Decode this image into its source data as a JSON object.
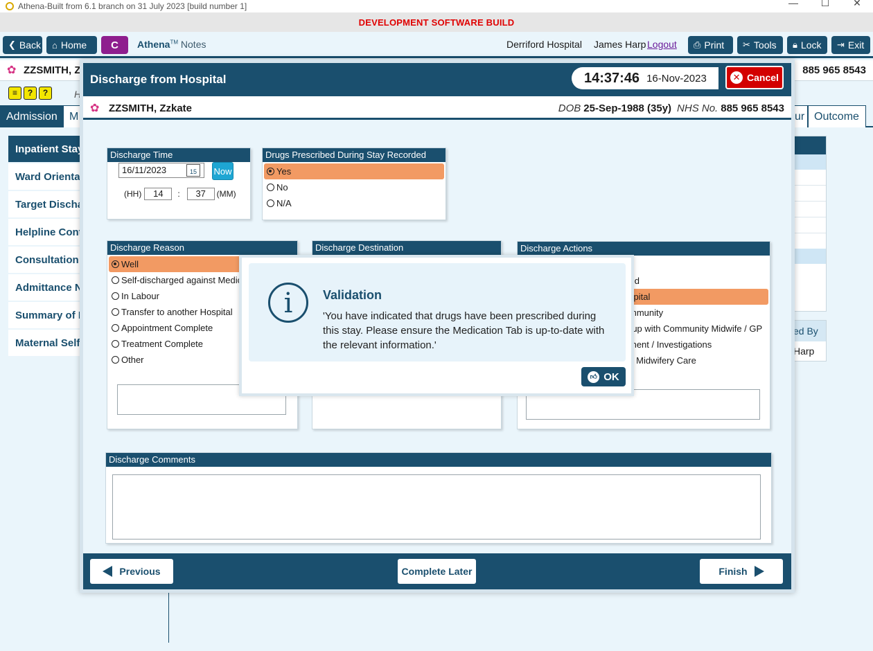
{
  "window": {
    "title": "Athena-Built from 6.1 branch on 31 July 2023 [build number 1]",
    "min_icon": "—",
    "max_icon": "☐",
    "close_icon": "✕"
  },
  "banner": "DEVELOPMENT SOFTWARE BUILD",
  "toolbar": {
    "back": "Back",
    "home": "Home",
    "c": "C",
    "app_name": "Athena",
    "tm": "TM",
    "notes": "Notes",
    "hospital": "Derriford Hospital",
    "user": "James Harp",
    "logout": "Logout",
    "print": "Print",
    "tools": "Tools",
    "lock": "Lock",
    "exit": "Exit"
  },
  "background": {
    "patient_name": "ZZSMITH, Z",
    "nhs_partial": "885 965 8543",
    "h_label": "H",
    "tabs": [
      "Admission",
      "M",
      "ur",
      "Outcome"
    ],
    "side_nav": [
      "Inpatient Stay",
      "Ward Orientat",
      "Target Discha",
      "Helpline Cont",
      "Consultation I",
      "Admittance N",
      "Summary of P",
      "Maternal Self"
    ],
    "recorded_by_label": "ed By",
    "recorded_by_value": "Harp"
  },
  "dialog": {
    "title": "Discharge from Hospital",
    "time": "14:37:46",
    "date": "16-Nov-2023",
    "cancel": "Cancel",
    "patient": {
      "name": "ZZSMITH, Zzkate",
      "dob_label": "DOB",
      "dob": "25-Sep-1988 (35y)",
      "nhs_label": "NHS No.",
      "nhs": "885 965 8543"
    },
    "discharge_time": {
      "title": "Discharge Time",
      "date": "16/11/2023",
      "cal_day": "15",
      "now": "Now",
      "hh_label": "(HH)",
      "hh": "14",
      "sep": ":",
      "mm": "37",
      "mm_label": "(MM)"
    },
    "drugs": {
      "title": "Drugs Prescribed During Stay Recorded",
      "options": [
        "Yes",
        "No",
        "N/A"
      ]
    },
    "reason": {
      "title": "Discharge Reason",
      "options": [
        "Well",
        "Self-discharged against Medica",
        "In Labour",
        "Transfer to another Hospital",
        "Appointment Complete",
        "Treatment Complete",
        "Other"
      ]
    },
    "destination": {
      "title": "Discharge Destination"
    },
    "actions": {
      "title": "Discharge Actions",
      "visible_fragments": [
        "ed",
        "spital",
        "mmunity",
        "-up with Community Midwife / GP",
        "ment / Investigations",
        "y Midwifery Care"
      ]
    },
    "comments": {
      "title": "Discharge Comments"
    },
    "footer": {
      "previous": "Previous",
      "complete_later": "Complete Later",
      "finish": "Finish"
    }
  },
  "validation": {
    "icon": "i",
    "title": "Validation",
    "message": "'You have indicated that drugs have been prescribed during this stay. Please ensure the Medication Tab is up-to-date with the relevant information.'",
    "ok": "OK"
  },
  "colors": {
    "primary": "#1a4f6e",
    "selected": "#f29a63",
    "cancel": "#d30000",
    "banner_text": "#e00000",
    "c_button": "#8e1e8e"
  }
}
